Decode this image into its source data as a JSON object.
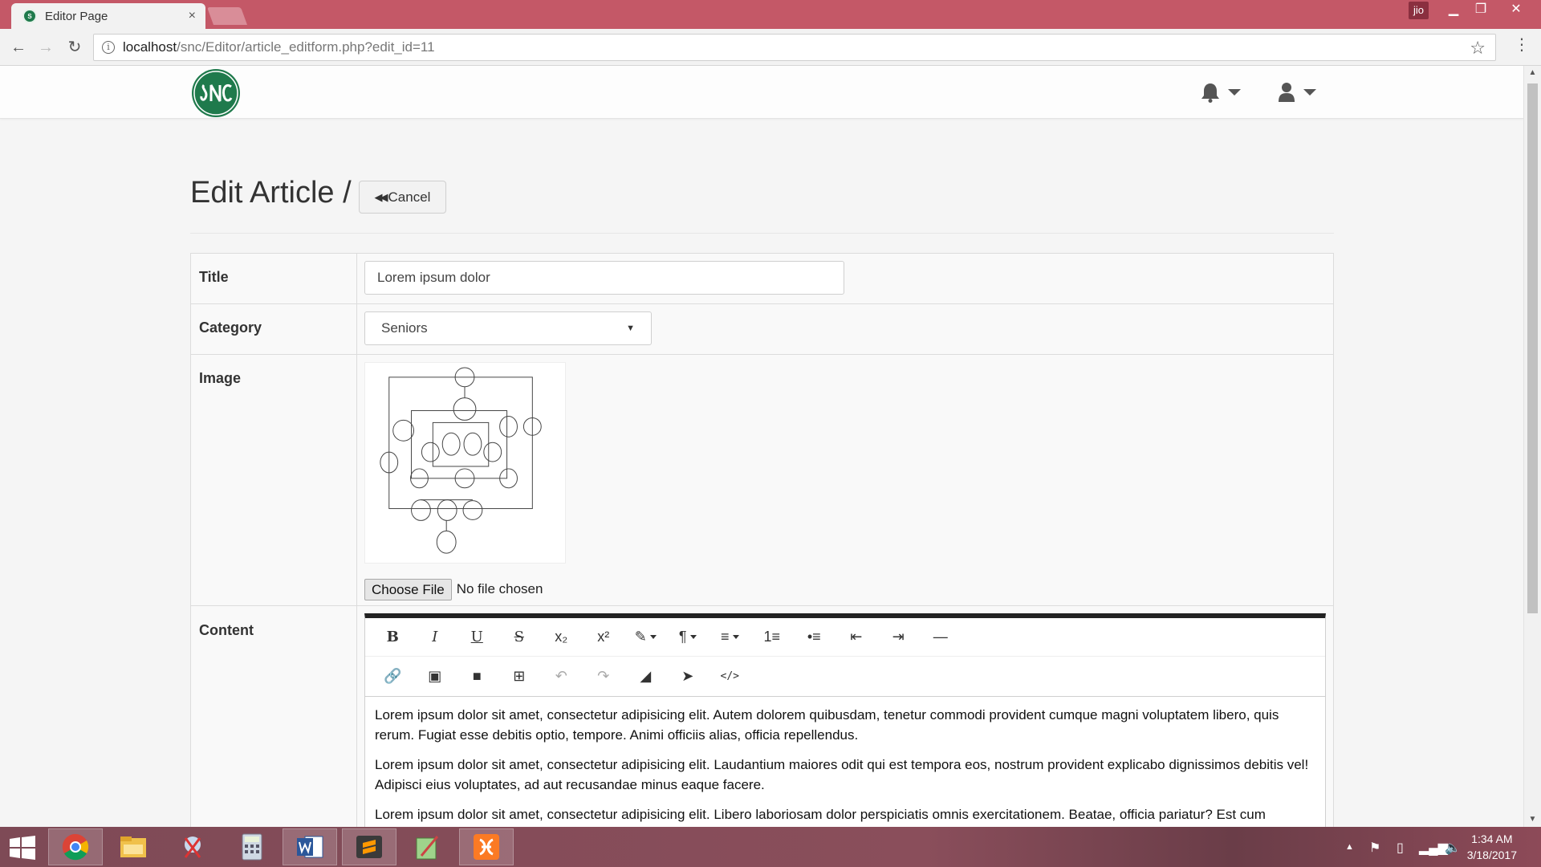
{
  "browser": {
    "tab_title": "Editor Page",
    "tab_close": "×",
    "profile_name": "jio",
    "url_host": "localhost",
    "url_path": "/snc/Editor/article_editform.php?edit_id=11"
  },
  "navbar": {
    "logo_text": "SNC"
  },
  "header": {
    "title": "Edit Article /",
    "cancel_label": "Cancel"
  },
  "form": {
    "title_label": "Title",
    "title_value": "Lorem ipsum dolor",
    "category_label": "Category",
    "category_value": "Seniors",
    "image_label": "Image",
    "file_button": "Choose File",
    "file_status": "No file chosen",
    "content_label": "Content",
    "content_paragraphs": [
      "Lorem ipsum dolor sit amet, consectetur adipisicing elit. Autem dolorem quibusdam, tenetur commodi provident cumque magni voluptatem libero, quis rerum. Fugiat esse debitis optio, tempore. Animi officiis alias, officia repellendus.",
      "Lorem ipsum dolor sit amet, consectetur adipisicing elit. Laudantium maiores odit qui est tempora eos, nostrum provident explicabo dignissimos debitis vel! Adipisci eius voluptates, ad aut recusandae minus eaque facere.",
      "Lorem ipsum dolor sit amet, consectetur adipisicing elit. Libero laboriosam dolor perspiciatis omnis exercitationem. Beatae, officia pariatur? Est cum"
    ]
  },
  "toolbar": {
    "row1": [
      {
        "name": "bold-icon",
        "glyph": "B"
      },
      {
        "name": "italic-icon",
        "glyph": "I"
      },
      {
        "name": "underline-icon",
        "glyph": "U"
      },
      {
        "name": "strikethrough-icon",
        "glyph": "S"
      },
      {
        "name": "subscript-icon",
        "glyph": "x₂"
      },
      {
        "name": "superscript-icon",
        "glyph": "x²"
      },
      {
        "name": "magic-style-icon",
        "glyph": "✎"
      },
      {
        "name": "paragraph-icon",
        "glyph": "¶"
      },
      {
        "name": "align-icon",
        "glyph": "≡"
      },
      {
        "name": "ordered-list-icon",
        "glyph": "1≡"
      },
      {
        "name": "unordered-list-icon",
        "glyph": "•≡"
      },
      {
        "name": "outdent-icon",
        "glyph": "⇤"
      },
      {
        "name": "indent-icon",
        "glyph": "⇥"
      },
      {
        "name": "horizontal-rule-icon",
        "glyph": "—"
      }
    ],
    "row2": [
      {
        "name": "link-icon",
        "glyph": "🔗"
      },
      {
        "name": "picture-icon",
        "glyph": "▣"
      },
      {
        "name": "video-icon",
        "glyph": "■"
      },
      {
        "name": "table-icon",
        "glyph": "⊞"
      },
      {
        "name": "undo-icon",
        "glyph": "↶"
      },
      {
        "name": "redo-icon",
        "glyph": "↷"
      },
      {
        "name": "eraser-icon",
        "glyph": "◢"
      },
      {
        "name": "cursor-icon",
        "glyph": "➤"
      },
      {
        "name": "code-view-icon",
        "glyph": "</>"
      }
    ]
  },
  "taskbar": {
    "time": "1:34 AM",
    "date": "3/18/2017"
  }
}
